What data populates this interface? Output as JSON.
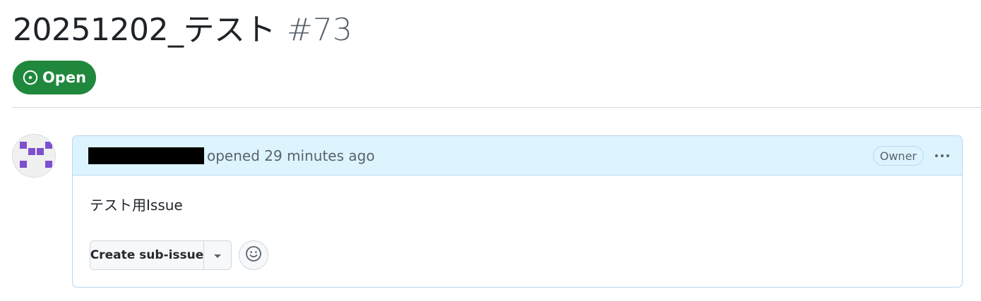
{
  "issue": {
    "title": "20251202_テスト",
    "number": "#73",
    "state_label": "Open",
    "state_icon": "issue-opened-icon",
    "state_color": "#1f883d"
  },
  "comment": {
    "author": "[redacted]",
    "opened_text": "opened 29 minutes ago",
    "role_badge": "Owner",
    "more_icon": "kebab-horizontal-icon",
    "body": "テスト用Issue",
    "header_bg": "#ddf4ff"
  },
  "actions": {
    "create_sub_issue_label": "Create sub-issue",
    "dropdown_icon": "triangle-down-icon",
    "reaction_icon": "smiley-icon"
  }
}
